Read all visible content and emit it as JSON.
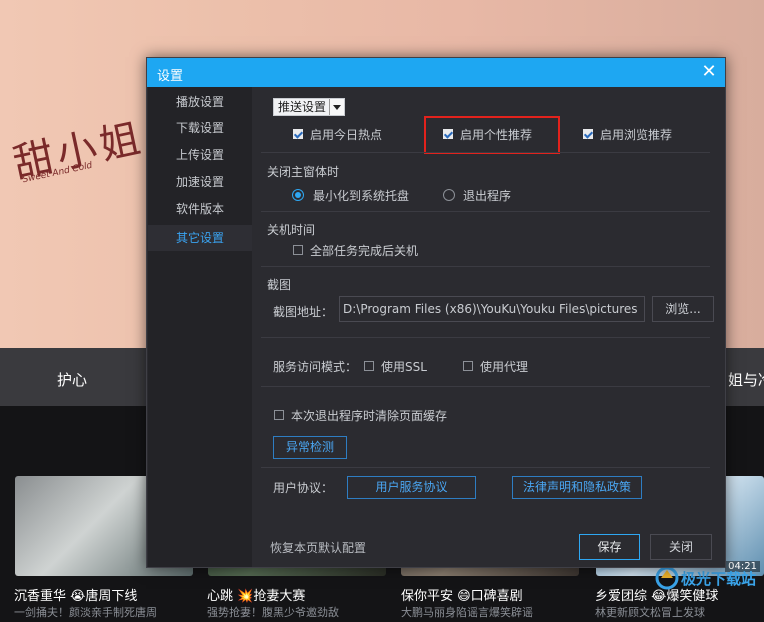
{
  "background": {
    "hero_title": "甜小姐与冷先生",
    "hero_subtitle": "Sweet And Cold",
    "strip_left": "护心",
    "strip_right": "姐与冷",
    "thumb4_badge": "04:21",
    "cards": [
      {
        "title": "沉香重华 😭唐周下线",
        "subtitle": "一剑捅夫！颜淡亲手制死唐周"
      },
      {
        "title": "心跳 💥抢妻大赛",
        "subtitle": "强势抢妻！腹黑少爷邀劲敌"
      },
      {
        "title": "保你平安 😄口碑喜剧",
        "subtitle": "大鹏马丽身陷谣言爆笑辟谣"
      },
      {
        "title": "乡爱团综 😂爆笑健球",
        "subtitle": "林更新顾文松冒上发球"
      }
    ],
    "watermark": "极光下载站"
  },
  "dialog": {
    "title": "设置",
    "close_glyph": "✕",
    "nav": [
      "播放设置",
      "下载设置",
      "上传设置",
      "加速设置",
      "软件版本",
      "其它设置"
    ],
    "push": {
      "select_value": "推送设置",
      "options": [
        {
          "label": "启用今日热点",
          "checked": true
        },
        {
          "label": "启用个性推荐",
          "checked": true
        },
        {
          "label": "启用浏览推荐",
          "checked": true
        }
      ]
    },
    "close_main": {
      "heading": "关闭主窗体时",
      "options": [
        {
          "label": "最小化到系统托盘",
          "selected": true
        },
        {
          "label": "退出程序",
          "selected": false
        }
      ]
    },
    "shutdown": {
      "heading": "关机时间",
      "option": "全部任务完成后关机",
      "checked": false
    },
    "screenshot": {
      "heading": "截图",
      "path_label": "截图地址：",
      "path_value": "D:\\Program Files (x86)\\YouKu\\Youku Files\\pictures",
      "browse_label": "浏览..."
    },
    "service": {
      "label": "服务访问模式：",
      "ssl": "使用SSL",
      "proxy": "使用代理",
      "ssl_checked": false,
      "proxy_checked": false
    },
    "clear_cache": {
      "label": "本次退出程序时清除页面缓存",
      "checked": false
    },
    "anomaly_button": "异常检测",
    "agreement": {
      "label": "用户协议：",
      "service_button": "用户服务协议",
      "legal_button": "法律声明和隐私政策"
    },
    "footer": {
      "restore": "恢复本页默认配置",
      "save": "保存",
      "close": "关闭"
    }
  },
  "colors": {
    "accent": "#1ea7f2",
    "highlight_box": "#e2221c",
    "dialog_bg": "#2b2b30"
  }
}
